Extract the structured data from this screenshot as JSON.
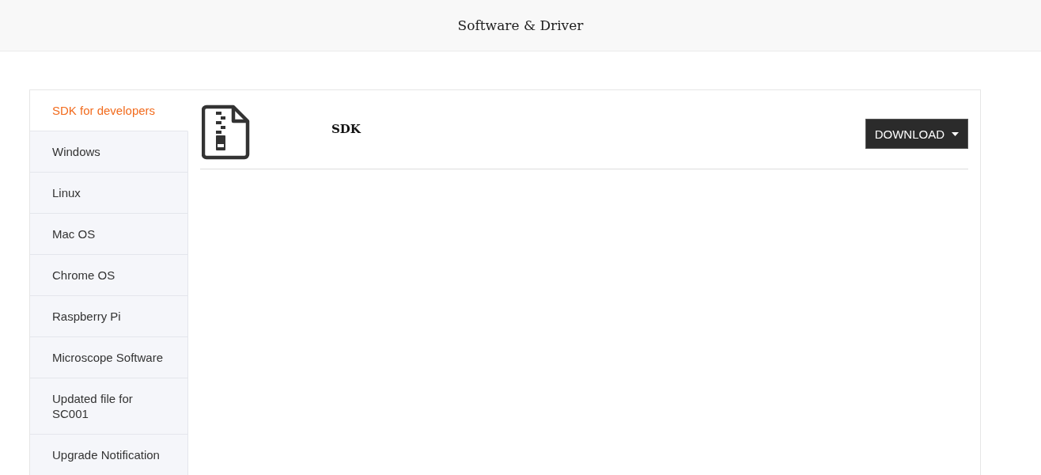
{
  "header": {
    "title": "Software & Driver"
  },
  "sidebar": {
    "items": [
      {
        "label": "SDK for developers",
        "selected": true
      },
      {
        "label": "Windows",
        "selected": false
      },
      {
        "label": "Linux",
        "selected": false
      },
      {
        "label": "Mac OS",
        "selected": false
      },
      {
        "label": "Chrome OS",
        "selected": false
      },
      {
        "label": "Raspberry Pi",
        "selected": false
      },
      {
        "label": "Microscope Software",
        "selected": false
      },
      {
        "label": "Updated file for SC001",
        "selected": false
      },
      {
        "label": "Upgrade Notification",
        "selected": false
      }
    ]
  },
  "files": [
    {
      "name": "SDK",
      "button": "DOWNLOAD"
    }
  ]
}
